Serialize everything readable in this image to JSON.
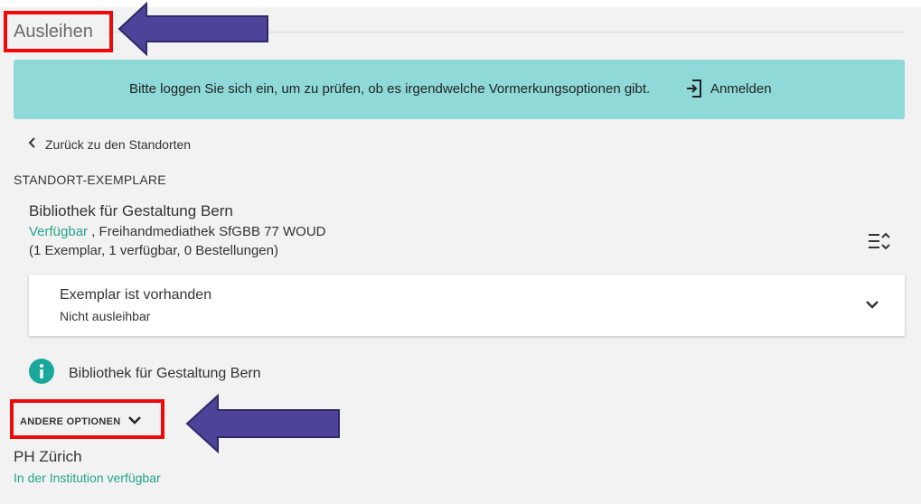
{
  "section": {
    "title": "Ausleihen"
  },
  "login_banner": {
    "message": "Bitte loggen Sie sich ein, um zu prüfen, ob es irgendwelche Vormerkungsoptionen gibt.",
    "button_label": "Anmelden",
    "background": "#8fd9d9"
  },
  "back_link": {
    "label": "Zurück zu den Standorten"
  },
  "locations": {
    "heading": "STANDORT-EXEMPLARE",
    "library_name": "Bibliothek für Gestaltung Bern",
    "status": "Verfügbar",
    "location_detail": " , Freihandmediathek SfGBB 77 WOUD",
    "summary": "(1 Exemplar, 1 verfügbar, 0 Bestellungen)"
  },
  "item": {
    "title": "Exemplar ist vorhanden",
    "subtitle": "Nicht ausleihbar"
  },
  "info": {
    "label": "Bibliothek für Gestaltung Bern",
    "icon": "info-icon"
  },
  "other_options": {
    "label": "ANDERE OPTIONEN"
  },
  "alternative": {
    "library": "PH Zürich",
    "status": "In der Institution verfügbar"
  },
  "colors": {
    "accent_green": "#23a489",
    "highlight_red": "#ee0a0a",
    "arrow_fill": "#4d4499",
    "info_teal": "#1aa79c"
  }
}
